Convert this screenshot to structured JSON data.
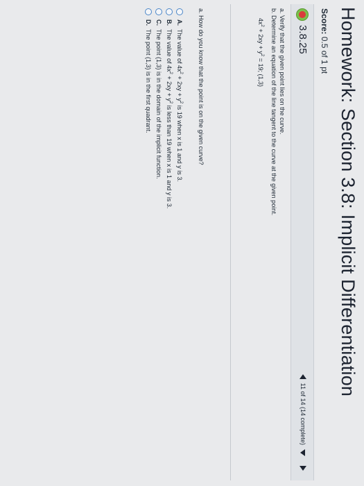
{
  "header": {
    "title": "Homework: Section 3.8: Implicit Differentiation",
    "score_label": "Score:",
    "score_value": "0.5 of 1 pt"
  },
  "question_bar": {
    "question_number": "3.8.25",
    "status_icon": "partial-credit-icon",
    "progress_text": "11 of 14 (14 complete)"
  },
  "problem": {
    "part_a": "a. Verify that the given point lies on the curve.",
    "part_b": "b. Determine an equation of the line tangent to the curve at the given point.",
    "equation_parts": [
      "4x",
      "2",
      " + 2xy + y",
      "2",
      " = 19; (1,3)"
    ]
  },
  "part_a_question": "a. How do you know that the point is on the given curve?",
  "options": [
    {
      "letter": "A.",
      "parts": [
        "The value of 4x",
        "2",
        " + 2xy + y",
        "2",
        " is 19 when x is 1 and y is 3."
      ]
    },
    {
      "letter": "B.",
      "parts": [
        "The value of 4x",
        "2",
        " + 2xy + y",
        "2",
        " is less than 19 when x is 1 and y is 3."
      ]
    },
    {
      "letter": "C.",
      "parts": [
        "The point (1,3) is in the domain of the implicit function."
      ]
    },
    {
      "letter": "D.",
      "parts": [
        "The point (1,3) is in the first quadrant."
      ]
    }
  ],
  "colors": {
    "radio_border": "#4b86c8",
    "status_green": "#7cc04b",
    "status_red": "#d93b3b"
  }
}
